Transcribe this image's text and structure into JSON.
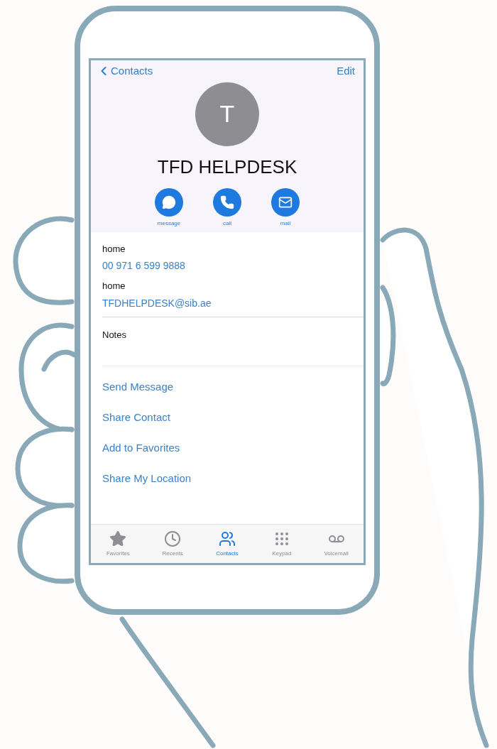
{
  "nav": {
    "back": "Contacts",
    "action": "Edit"
  },
  "contact": {
    "initial": "T",
    "name": "TFD HELPDESK"
  },
  "actions": [
    {
      "kind": "message",
      "label": "message"
    },
    {
      "kind": "call",
      "label": "call"
    },
    {
      "kind": "mail",
      "label": "mail"
    }
  ],
  "fields": [
    {
      "label": "home",
      "value": "00 971 6 599 9888"
    },
    {
      "label": "home",
      "value": "TFDHELPDESK@sib.ae"
    }
  ],
  "notes": {
    "label": "Notes"
  },
  "links": [
    "Send Message",
    "Share Contact",
    "Add to Favorites",
    "Share My Location"
  ],
  "tab_bar": [
    {
      "kind": "favorites",
      "label": "Favorites",
      "selected": false
    },
    {
      "kind": "recents",
      "label": "Recents",
      "selected": false
    },
    {
      "kind": "contacts",
      "label": "Contacts",
      "selected": true
    },
    {
      "kind": "keypad",
      "label": "Keypad",
      "selected": false
    },
    {
      "kind": "voicemail",
      "label": "Voicemail",
      "selected": false
    }
  ]
}
